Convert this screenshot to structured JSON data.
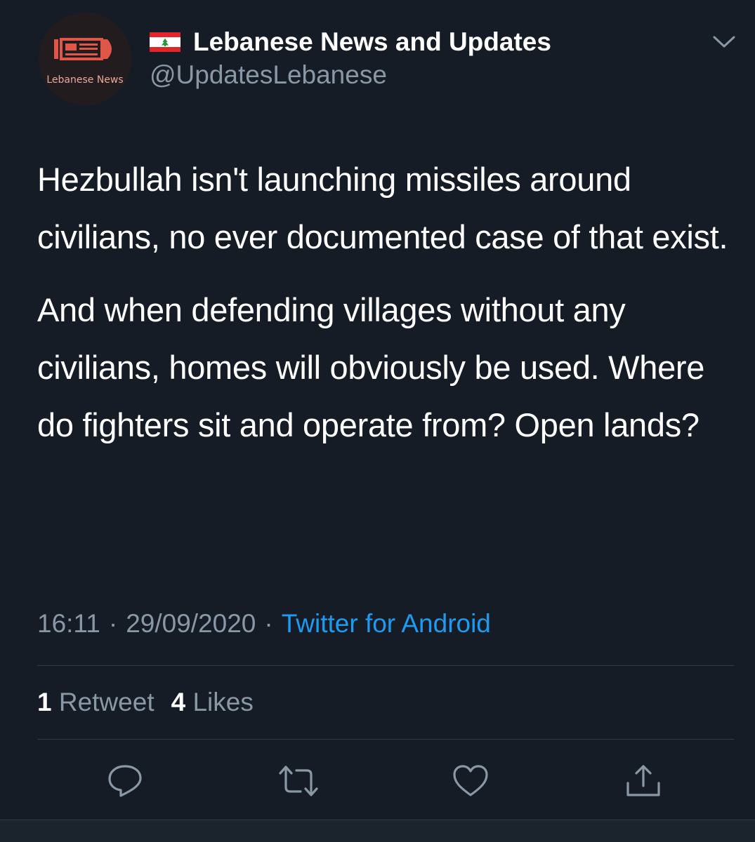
{
  "author": {
    "flag_icon": "lebanon-flag-icon",
    "display_name": "Lebanese News and Updates",
    "handle": "@UpdatesLebanese",
    "avatar_label": "Lebanese News"
  },
  "tweet": {
    "paragraphs": [
      "Hezbullah isn't launching missiles around civilians, no ever documented case of that exist.",
      "And when defending villages without any civilians, homes will obviously be used. Where do fighters sit and operate from? Open lands?"
    ],
    "time": "16:11",
    "date": "29/09/2020",
    "separator": "·",
    "source": "Twitter for Android"
  },
  "stats": {
    "retweets_count": "1",
    "retweets_label": "Retweet",
    "likes_count": "4",
    "likes_label": "Likes"
  },
  "actions": [
    {
      "name": "reply",
      "icon": "reply-icon"
    },
    {
      "name": "retweet",
      "icon": "retweet-icon"
    },
    {
      "name": "like",
      "icon": "heart-icon"
    },
    {
      "name": "share",
      "icon": "share-icon"
    }
  ],
  "colors": {
    "background": "#151c26",
    "text": "#ffffff",
    "muted": "#8a98a6",
    "link": "#1d9bf0",
    "divider": "#323b46",
    "avatar_accent": "#e0574a"
  }
}
